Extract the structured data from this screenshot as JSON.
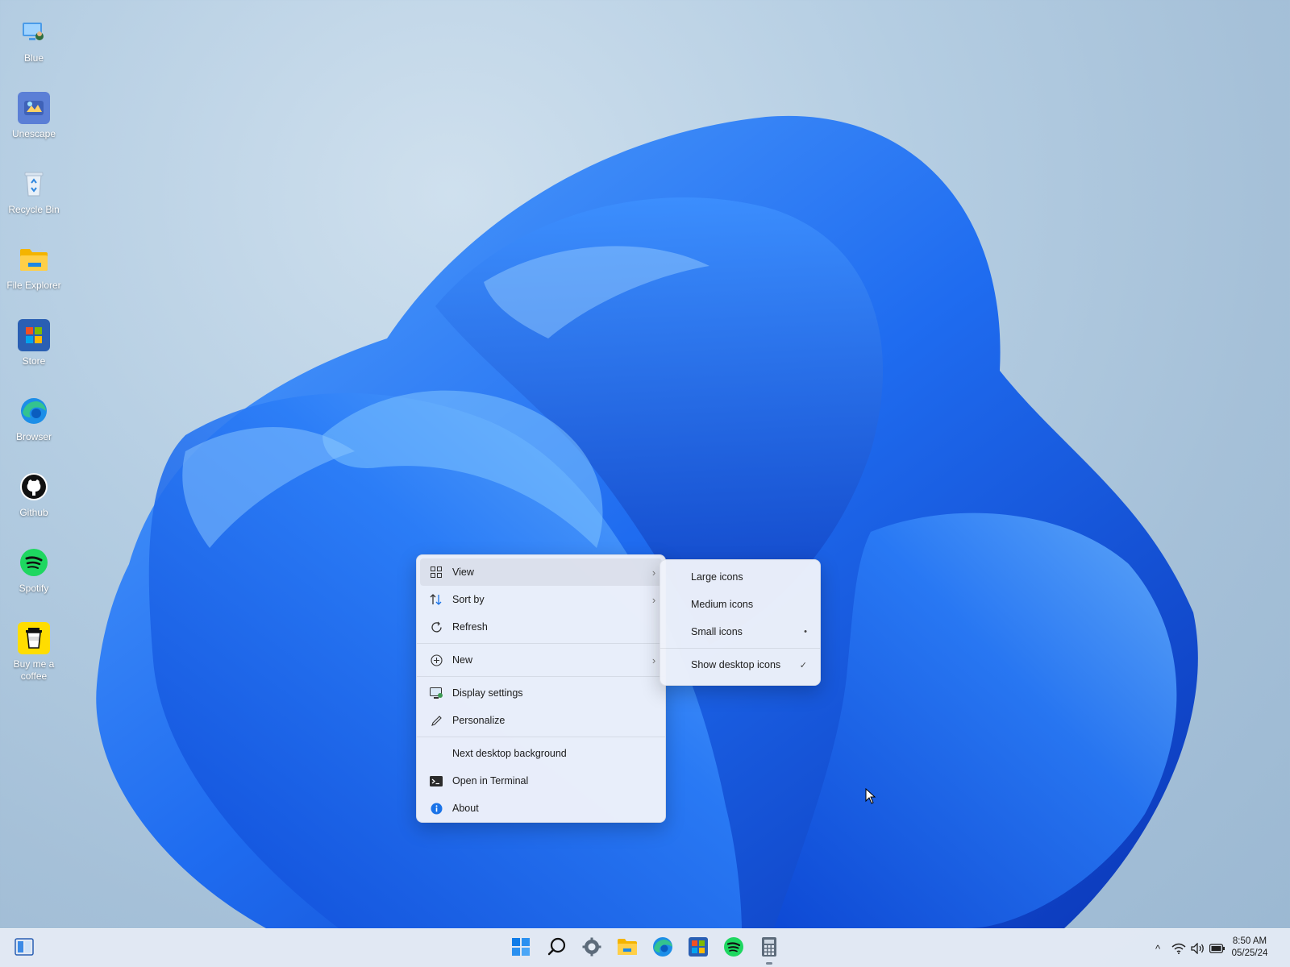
{
  "desktop": {
    "icons": [
      {
        "label": "Blue",
        "icon": "user-monitor-icon"
      },
      {
        "label": "Unescape",
        "icon": "unescape-app-icon"
      },
      {
        "label": "Recycle Bin",
        "icon": "recycle-bin-icon"
      },
      {
        "label": "File Explorer",
        "icon": "folder-icon"
      },
      {
        "label": "Store",
        "icon": "store-icon"
      },
      {
        "label": "Browser",
        "icon": "edge-browser-icon"
      },
      {
        "label": "Github",
        "icon": "github-icon"
      },
      {
        "label": "Spotify",
        "icon": "spotify-icon"
      },
      {
        "label": "Buy me a coffee",
        "icon": "coffee-cup-icon"
      }
    ]
  },
  "context_menu": {
    "items": [
      {
        "label": "View",
        "icon": "grid-icon",
        "submenu": true
      },
      {
        "label": "Sort by",
        "icon": "sort-arrows-icon",
        "submenu": true
      },
      {
        "label": "Refresh",
        "icon": "refresh-icon",
        "submenu": false
      },
      {
        "label": "New",
        "icon": "plus-circle-icon",
        "submenu": true
      },
      {
        "label": "Display settings",
        "icon": "display-icon",
        "submenu": false
      },
      {
        "label": "Personalize",
        "icon": "pen-icon",
        "submenu": false
      },
      {
        "label": "Next desktop background",
        "icon": "",
        "submenu": false
      },
      {
        "label": "Open in Terminal",
        "icon": "terminal-icon",
        "submenu": false
      },
      {
        "label": "About",
        "icon": "info-icon",
        "submenu": false
      }
    ],
    "chevron": "›"
  },
  "view_submenu": {
    "items": [
      {
        "label": "Large icons",
        "mark": ""
      },
      {
        "label": "Medium icons",
        "mark": ""
      },
      {
        "label": "Small icons",
        "mark": "•"
      },
      {
        "label": "Show desktop icons",
        "mark": "✓"
      }
    ]
  },
  "taskbar": {
    "apps": [
      "start-icon",
      "search-icon",
      "settings-icon",
      "file-explorer-icon",
      "edge-icon",
      "store-icon",
      "spotify-icon",
      "calculator-icon"
    ],
    "tray_chevron": "^",
    "time": "8:50 AM",
    "date": "05/25/24"
  },
  "colors": {
    "accent": "#1a73e8",
    "bloom_dark": "#0a3fc4",
    "bloom_light": "#3d8ff5"
  }
}
